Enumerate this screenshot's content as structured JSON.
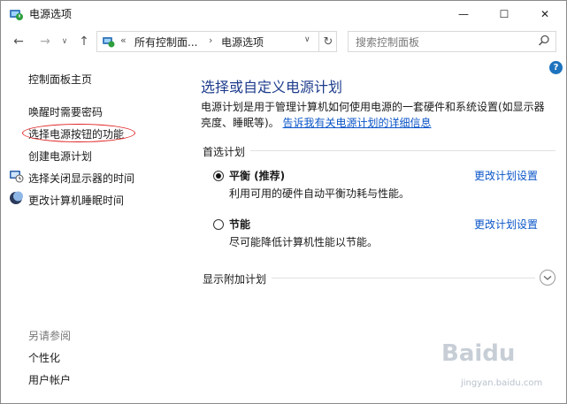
{
  "window": {
    "title": "电源选项",
    "minimize_glyph": "—",
    "maximize_glyph": "☐",
    "close_glyph": "✕"
  },
  "navigation": {
    "back_glyph": "←",
    "forward_glyph": "→",
    "dropdown_glyph": "∨",
    "up_glyph": "↑",
    "address": {
      "overflow_chevron": "«",
      "crumb_separator": "›",
      "crumbs": [
        "所有控制面...",
        "电源选项"
      ],
      "dropdown_glyph": "∨",
      "refresh_glyph": "↻"
    },
    "search_placeholder": "搜索控制面板"
  },
  "help_label": "?",
  "sidebar": {
    "home": "控制面板主页",
    "links": [
      "唤醒时需要密码",
      "选择电源按钮的功能",
      "创建电源计划",
      "选择关闭显示器的时间",
      "更改计算机睡眠时间"
    ],
    "see_also_title": "另请参阅",
    "see_also": [
      "个性化",
      "用户帐户"
    ]
  },
  "main": {
    "title": "选择或自定义电源计划",
    "description": "电源计划是用于管理计算机如何使用电源的一套硬件和系统设置(如显示器亮度、睡眠等)。",
    "description_link": "告诉我有关电源计划的详细信息",
    "preferred_label": "首选计划",
    "plans": [
      {
        "name": "平衡 (推荐)",
        "desc": "利用可用的硬件自动平衡功耗与性能。",
        "link": "更改计划设置",
        "selected": true
      },
      {
        "name": "节能",
        "desc": "尽可能降低计算机性能以节能。",
        "link": "更改计划设置",
        "selected": false
      }
    ],
    "additional_label": "显示附加计划"
  },
  "watermark": {
    "text": "Baidu",
    "sub": "jingyan.baidu.com"
  },
  "colors": {
    "title_blue": "#1e3c8c",
    "link_blue": "#0a55c8",
    "annotation_red": "#e02020",
    "help_blue": "#1e73be"
  }
}
